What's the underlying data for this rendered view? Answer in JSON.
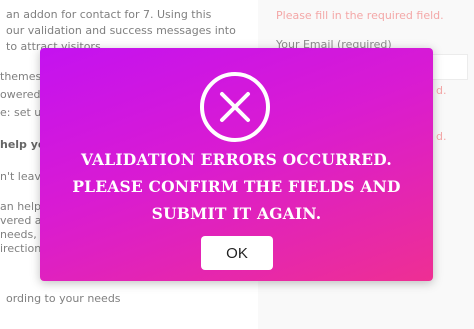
{
  "background": {
    "left_lines": [
      "an addon for contact for 7. Using this",
      "our validation and success messages into",
      "to attract visitors.",
      "themes",
      "owered",
      "e: set u",
      "help yo",
      "n't leav",
      "an help",
      "vered a",
      "needs, w",
      "irection",
      "ording to your needs"
    ],
    "right_lines": {
      "required_notice": "Please fill in the required field.",
      "email_label": "Your Email (required)",
      "notice_2": "d.",
      "notice_3": "d."
    }
  },
  "modal": {
    "message": "VALIDATION ERRORS OCCURRED. PLEASE CONFIRM THE FIELDS AND SUBMIT IT AGAIN.",
    "ok_label": "OK",
    "icon": "close-circle-icon",
    "colors": {
      "gradient_start": "#c412f0",
      "gradient_end": "#ee2f93",
      "text": "#ffffff",
      "button_bg": "#ffffff"
    }
  }
}
